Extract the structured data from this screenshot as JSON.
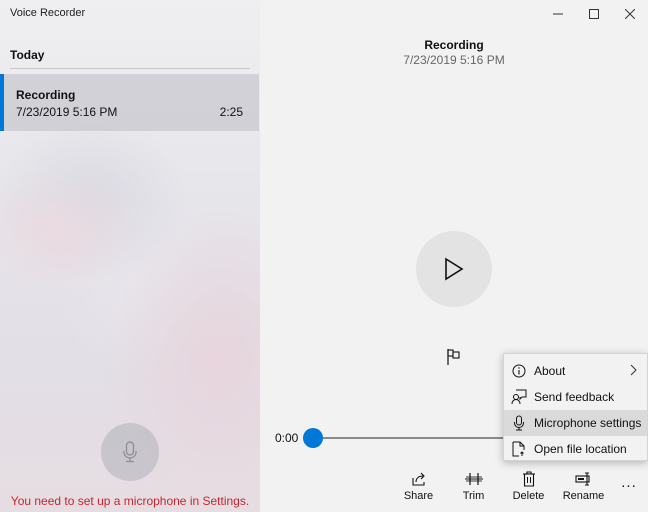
{
  "app": {
    "title": "Voice Recorder",
    "window_controls": [
      "minimize",
      "maximize",
      "close"
    ]
  },
  "sidebar": {
    "section_header": "Today",
    "recordings": [
      {
        "title": "Recording",
        "date": "7/23/2019 5:16 PM",
        "duration": "2:25",
        "selected": true
      }
    ],
    "mic_icon": "microphone-icon",
    "warning": "You need to set up a microphone in Settings."
  },
  "main": {
    "recording_title": "Recording",
    "recording_date": "7/23/2019 5:16 PM",
    "play_icon": "play-icon",
    "flag_icon": "flag-icon",
    "playback": {
      "current_time": "0:00",
      "progress": 0
    }
  },
  "toolbar": {
    "items": [
      {
        "label": "Share",
        "icon": "share-icon"
      },
      {
        "label": "Trim",
        "icon": "trim-icon"
      },
      {
        "label": "Delete",
        "icon": "trash-icon"
      },
      {
        "label": "Rename",
        "icon": "rename-icon"
      }
    ],
    "more_label": "..."
  },
  "context_menu": {
    "items": [
      {
        "label": "About",
        "icon": "info-icon",
        "has_submenu": true
      },
      {
        "label": "Send feedback",
        "icon": "feedback-icon"
      },
      {
        "label": "Microphone settings",
        "icon": "microphone-icon",
        "highlighted": true
      },
      {
        "label": "Open file location",
        "icon": "file-icon"
      }
    ]
  },
  "colors": {
    "accent": "#0078d7",
    "warning": "#c5262d"
  }
}
